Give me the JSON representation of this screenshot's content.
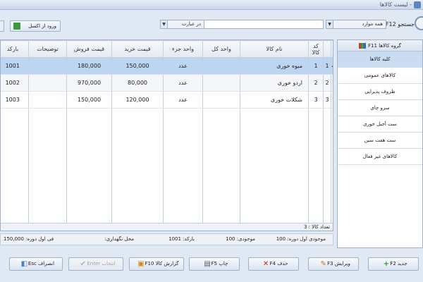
{
  "window": {
    "title": "- لیست کالاها"
  },
  "toolbar": {
    "search_label": "جستجو F12",
    "field_combo": "همه موارد",
    "mode_combo": "در عبارت",
    "search_value": "",
    "excel_button": "ورود از اکسل"
  },
  "grid": {
    "columns": [
      "کد کالا",
      "نام کالا",
      "واحد کل",
      "واحد جزء",
      "قیمت خرید",
      "قیمت فروش",
      "توضیحات",
      "بارکد"
    ],
    "rows": [
      {
        "index": "1",
        "code": "1",
        "name": "میوه خوری",
        "unit_total": "",
        "unit_part": "عدد",
        "buy": "150,000",
        "sell": "180,000",
        "desc": "",
        "barcode": "1001"
      },
      {
        "index": "2",
        "code": "2",
        "name": "اردو خوری",
        "unit_total": "",
        "unit_part": "عدد",
        "buy": "80,000",
        "sell": "970,000",
        "desc": "",
        "barcode": "1002"
      },
      {
        "index": "3",
        "code": "3",
        "name": "شکلات خوری",
        "unit_total": "",
        "unit_part": "عدد",
        "buy": "120,000",
        "sell": "150,000",
        "desc": "",
        "barcode": "1003"
      }
    ],
    "count_label": "تعداد کالا : 3"
  },
  "sidebar": {
    "header": "گروه کالاها F11",
    "items": [
      "کلیه کالاها",
      "کالاهای عمومی",
      "ظروف پذیرایی",
      "سرو چای",
      "ست آجیل خوری",
      "ست هفت سین",
      "کالاهای غیر فعال"
    ]
  },
  "info": {
    "stock_start": "موجودی اول دوره: 100",
    "stock": "موجودی: 100",
    "barcode": "بارکد: 1001",
    "location": "محل نگهداری:",
    "price_start": "فی اول دوره: 150,000"
  },
  "actions": {
    "new": "جدید F2",
    "edit": "ویرایش F3",
    "delete": "حذف F4",
    "print": "چاپ F5",
    "report": "گزارش کالا F10",
    "select": "انتخاب Enter",
    "cancel": "انصراف Esc"
  },
  "colors": {
    "selected_row": "#bcd6f1",
    "accent": "#5b86c4"
  }
}
